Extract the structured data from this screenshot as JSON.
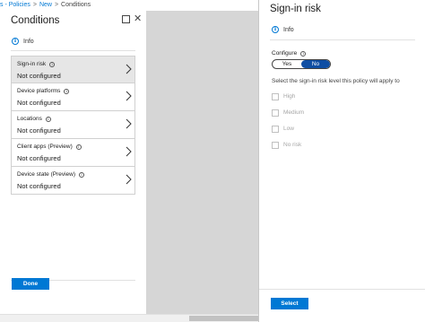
{
  "breadcrumb": {
    "items": [
      "s - Policies",
      "New",
      "Conditions"
    ],
    "separator": ">"
  },
  "conditions_panel": {
    "title": "Conditions",
    "info_label": "Info",
    "items": [
      {
        "name": "Sign-in risk",
        "value": "Not configured",
        "selected": true
      },
      {
        "name": "Device platforms",
        "value": "Not configured",
        "selected": false
      },
      {
        "name": "Locations",
        "value": "Not configured",
        "selected": false
      },
      {
        "name": "Client apps (Preview)",
        "value": "Not configured",
        "selected": false
      },
      {
        "name": "Device state (Preview)",
        "value": "Not configured",
        "selected": false
      }
    ],
    "done_label": "Done"
  },
  "risk_panel": {
    "title": "Sign-in risk",
    "info_label": "Info",
    "configure_label": "Configure",
    "toggle": {
      "yes": "Yes",
      "no": "No",
      "selected": "No"
    },
    "description": "Select the sign-in risk level this policy will apply to",
    "levels": [
      "High",
      "Medium",
      "Low",
      "No risk"
    ],
    "select_label": "Select"
  },
  "colors": {
    "accent": "#0078d4",
    "toggle_active": "#0f4ea3",
    "selected_row": "#e6e6e6",
    "overlay": "#d6d6d6"
  }
}
